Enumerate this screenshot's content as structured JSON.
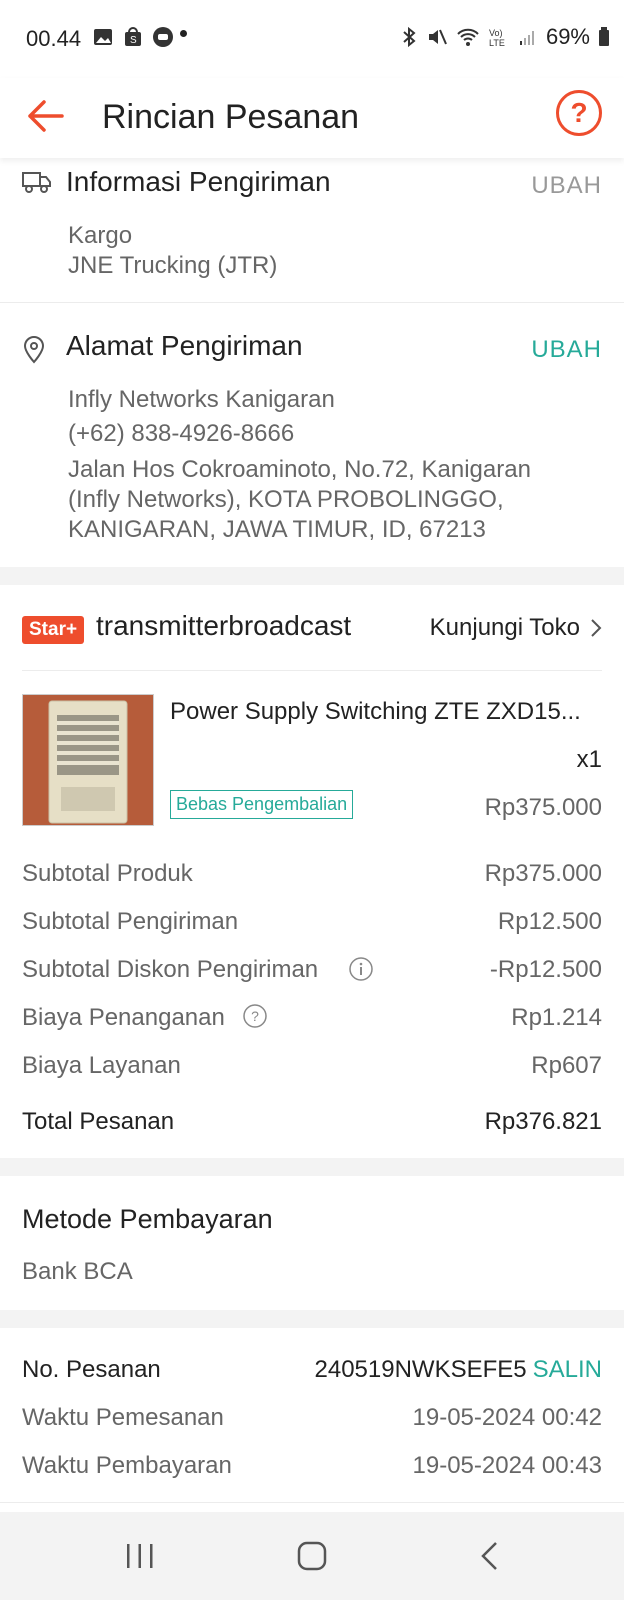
{
  "status_bar": {
    "time": "00.44",
    "battery": "69%"
  },
  "header": {
    "title": "Rincian Pesanan",
    "help_icon": "?"
  },
  "shipping_info": {
    "title": "Informasi Pengiriman",
    "action": "UBAH",
    "lines": [
      "Kargo",
      "JNE Trucking (JTR)"
    ]
  },
  "address": {
    "title": "Alamat Pengiriman",
    "action": "UBAH",
    "name": "Infly Networks Kanigaran",
    "phone": "(+62) 838-4926-8666",
    "line1": "Jalan Hos Cokroaminoto, No.72, Kanigaran",
    "line2": "(Infly Networks), KOTA PROBOLINGGO,",
    "line3": "KANIGARAN, JAWA TIMUR, ID, 67213"
  },
  "shop": {
    "badge": "Star+",
    "name": "transmitterbroadcast",
    "visit_label": "Kunjungi Toko"
  },
  "product": {
    "name": "Power Supply Switching ZTE ZXD15...",
    "quantity": "x1",
    "return_badge": "Bebas Pengembalian",
    "price": "Rp375.000"
  },
  "summary": {
    "rows": [
      {
        "label": "Subtotal Produk",
        "value": "Rp375.000"
      },
      {
        "label": "Subtotal Pengiriman",
        "value": "Rp12.500"
      },
      {
        "label": "Subtotal Diskon Pengiriman",
        "value": "-Rp12.500"
      },
      {
        "label": "Biaya Penanganan",
        "value": "Rp1.214"
      },
      {
        "label": "Biaya Layanan",
        "value": "Rp607"
      }
    ],
    "total_label": "Total Pesanan",
    "total_value": "Rp376.821"
  },
  "payment": {
    "title": "Metode Pembayaran",
    "method": "Bank BCA"
  },
  "order": {
    "number_label": "No. Pesanan",
    "number_value": "240519NWKSEFE5",
    "copy_label": "SALIN",
    "order_time_label": "Waktu Pemesanan",
    "order_time_value": "19-05-2024 00:42",
    "payment_time_label": "Waktu Pembayaran",
    "payment_time_value": "19-05-2024 00:43"
  },
  "colors": {
    "accent": "#ee4d2d",
    "teal": "#26aa99",
    "muted": "#999999"
  }
}
